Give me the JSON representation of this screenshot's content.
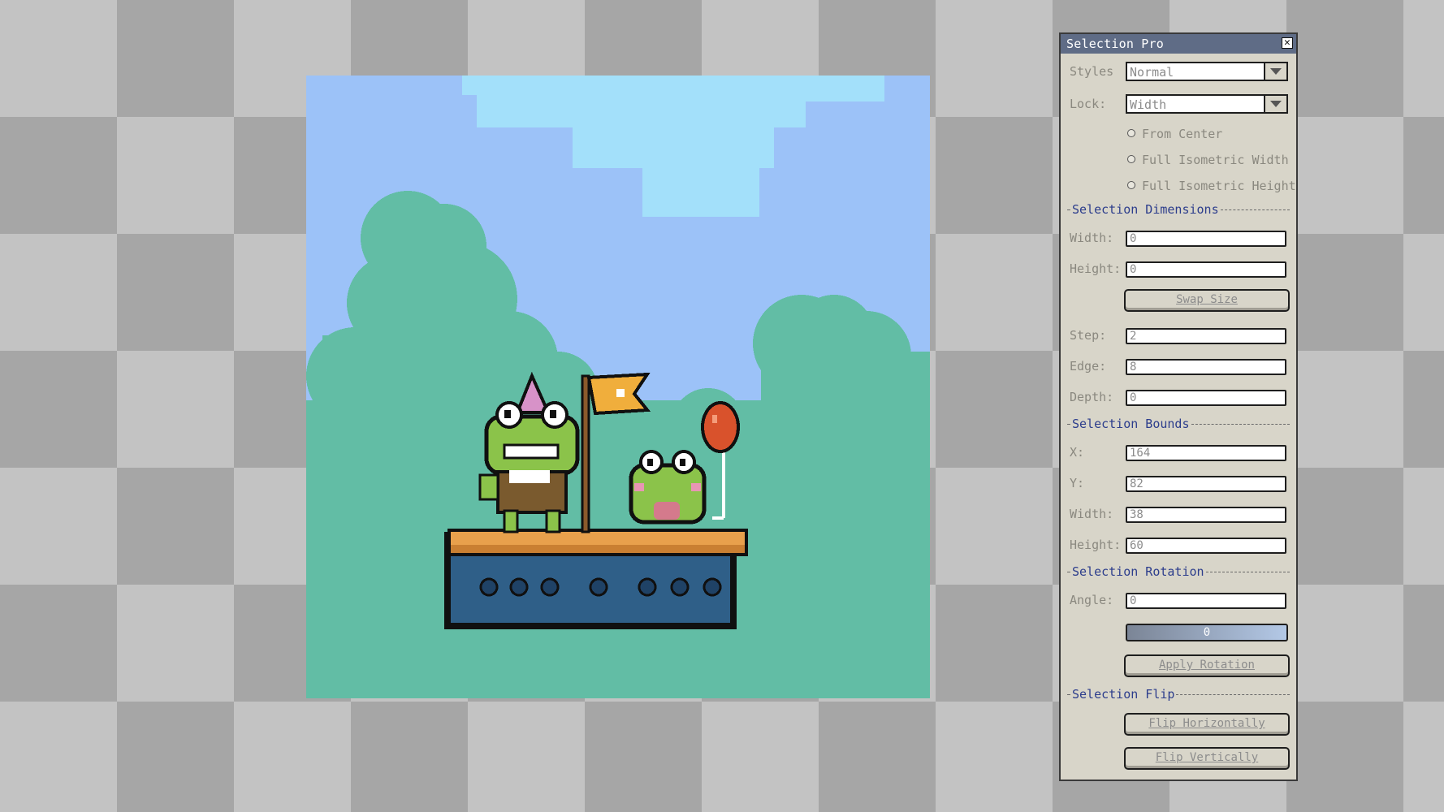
{
  "panel": {
    "title": "Selection Pro",
    "close_glyph": "✕",
    "styles": {
      "label": "Styles",
      "value": "Normal"
    },
    "lock": {
      "label": "Lock:",
      "value": "Width"
    },
    "options": [
      {
        "label": "From Center",
        "checked": false
      },
      {
        "label": "Full Isometric Width",
        "checked": false
      },
      {
        "label": "Full Isometric Height",
        "checked": false
      }
    ],
    "dimensions": {
      "heading": "Selection Dimensions",
      "width_label": "Width:",
      "width_value": "0",
      "height_label": "Height:",
      "height_value": "0",
      "swap_button": "Swap Size",
      "step_label": "Step:",
      "step_value": "2",
      "edge_label": "Edge:",
      "edge_value": "8",
      "depth_label": "Depth:",
      "depth_value": "0"
    },
    "bounds": {
      "heading": "Selection Bounds",
      "x_label": "X:",
      "x_value": "164",
      "y_label": "Y:",
      "y_value": "82",
      "width_label": "Width:",
      "width_value": "38",
      "height_label": "Height:",
      "height_value": "60"
    },
    "rotation": {
      "heading": "Selection Rotation",
      "angle_label": "Angle:",
      "angle_value": "0",
      "slider_value": "0",
      "apply_button": "Apply Rotation"
    },
    "flip": {
      "heading": "Selection Flip",
      "horizontal_button": "Flip Horizontally",
      "vertical_button": "Flip Vertically"
    }
  },
  "colors": {
    "sky": "#9cc2f8",
    "sky_light": "#a3e0fa",
    "foliage": "#62bda5",
    "panel_bg": "#d8d5c9",
    "titlebar": "#5f6c86",
    "section_heading": "#2c3d8c"
  }
}
